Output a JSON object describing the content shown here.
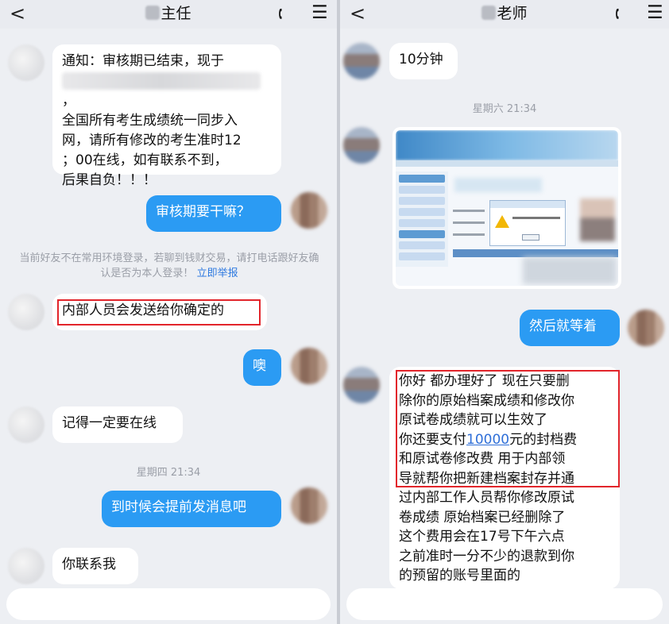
{
  "left_chat": {
    "header": {
      "back_glyph": "<",
      "title": "主任"
    },
    "messages": [
      {
        "side": "left",
        "lines": [
          "通知：审核期已结束，现于",
          "全国所有考生成绩统一同步入",
          "网，请所有修改的考生准时12",
          "；00在线，如有联系不到，",
          "后果自负！！！"
        ],
        "trailing_mark": "，"
      },
      {
        "side": "right",
        "text": "审核期要干嘛？"
      },
      {
        "side": "system",
        "text": "当前好友不在常用环境登录，若聊到钱财交易，请打电话跟好友确认是否为本人登录！",
        "link": "立即举报"
      },
      {
        "side": "left",
        "text": "内部人员会发送给你确定的"
      },
      {
        "side": "right",
        "text": "噢"
      },
      {
        "side": "left",
        "text": "记得一定要在线"
      },
      {
        "side": "timestamp",
        "text": "星期四 21:34"
      },
      {
        "side": "right",
        "text": "到时候会提前发消息吧"
      },
      {
        "side": "left",
        "text": "你联系我"
      }
    ]
  },
  "right_chat": {
    "header": {
      "back_glyph": "<",
      "title": "老师"
    },
    "messages": [
      {
        "side": "left",
        "text": "10分钟"
      },
      {
        "side": "timestamp",
        "text": "星期六 21:34"
      },
      {
        "side": "left",
        "type": "image",
        "description_hidden": true
      },
      {
        "side": "right",
        "text": "然后就等着"
      },
      {
        "side": "left",
        "lines": [
          "你好  都办理好了  现在只要删",
          "除你的原始档案成绩和修改你",
          "原试卷成绩就可以生效了",
          "你还要支付",
          "元的封档费",
          "和原试卷修改费 用于内部领",
          "导就帮你把新建档案封存并通",
          "过内部工作人员帮你修改原试",
          "卷成绩  原始档案已经删除了",
          " 这个费用会在17号下午六点",
          "之前准时一分不少的退款到你",
          "的预留的账号里面的"
        ],
        "amount": "10000"
      }
    ]
  },
  "icons": {
    "back": "chevron-left-icon",
    "phone": "phone-icon",
    "menu": "menu-icon"
  },
  "colors": {
    "bubble_blue": "#2b9bf3",
    "highlight_red": "#e2252b",
    "link_blue": "#2f7ae0"
  }
}
